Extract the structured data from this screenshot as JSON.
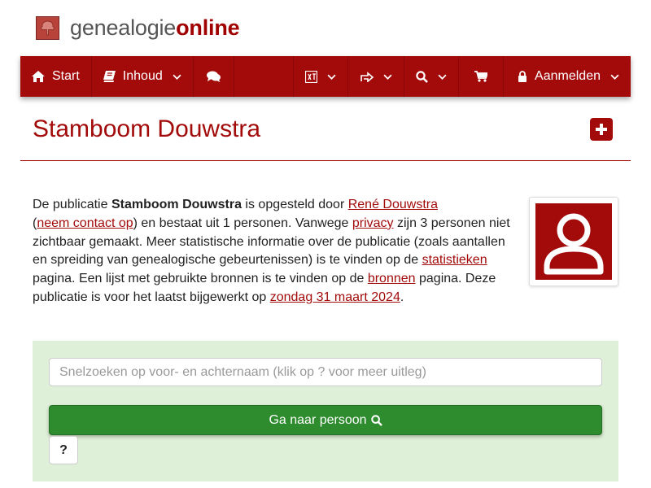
{
  "logo": {
    "part1": "genealogie",
    "part2": "online"
  },
  "nav": {
    "start": "Start",
    "contents": "Inhoud",
    "login": "Aanmelden",
    "icons": {
      "start": "home-icon",
      "contents": "book-icon",
      "chat": "comments-icon",
      "language": "language-icon",
      "share": "share-icon",
      "search": "search-icon",
      "cart": "cart-icon",
      "login": "lock-icon"
    }
  },
  "page": {
    "title": "Stamboom Douwstra"
  },
  "description": {
    "t1": "De publicatie ",
    "pub_name": "Stamboom Douwstra",
    "t2": " is opgesteld door ",
    "author": "René Douwstra",
    "t3": " (",
    "contact": "neem contact op",
    "t4": ") en bestaat uit 1 personen. Vanwege ",
    "privacy": "privacy",
    "t5": " zijn 3 personen niet zichtbaar gemaakt. Meer statistische informatie over de publicatie (zoals aantallen en spreiding van genealogische gebeurtenissen) is te vinden op de ",
    "stats": "statistieken",
    "t6": " pagina. Een lijst met gebruikte bronnen is te vinden op de ",
    "sources": "bronnen",
    "t7": " pagina. Deze publicatie is voor het laatst bijgewerkt op ",
    "updated": "zondag 31 maart 2024",
    "t8": "."
  },
  "search": {
    "placeholder": "Snelzoeken op voor- en achternaam (klik op ? voor meer uitleg)",
    "go_label": "Ga naar persoon",
    "help_label": "?"
  },
  "colors": {
    "brand": "#a30b0b",
    "panel": "#dff0d8",
    "button": "#2e8b2e"
  }
}
